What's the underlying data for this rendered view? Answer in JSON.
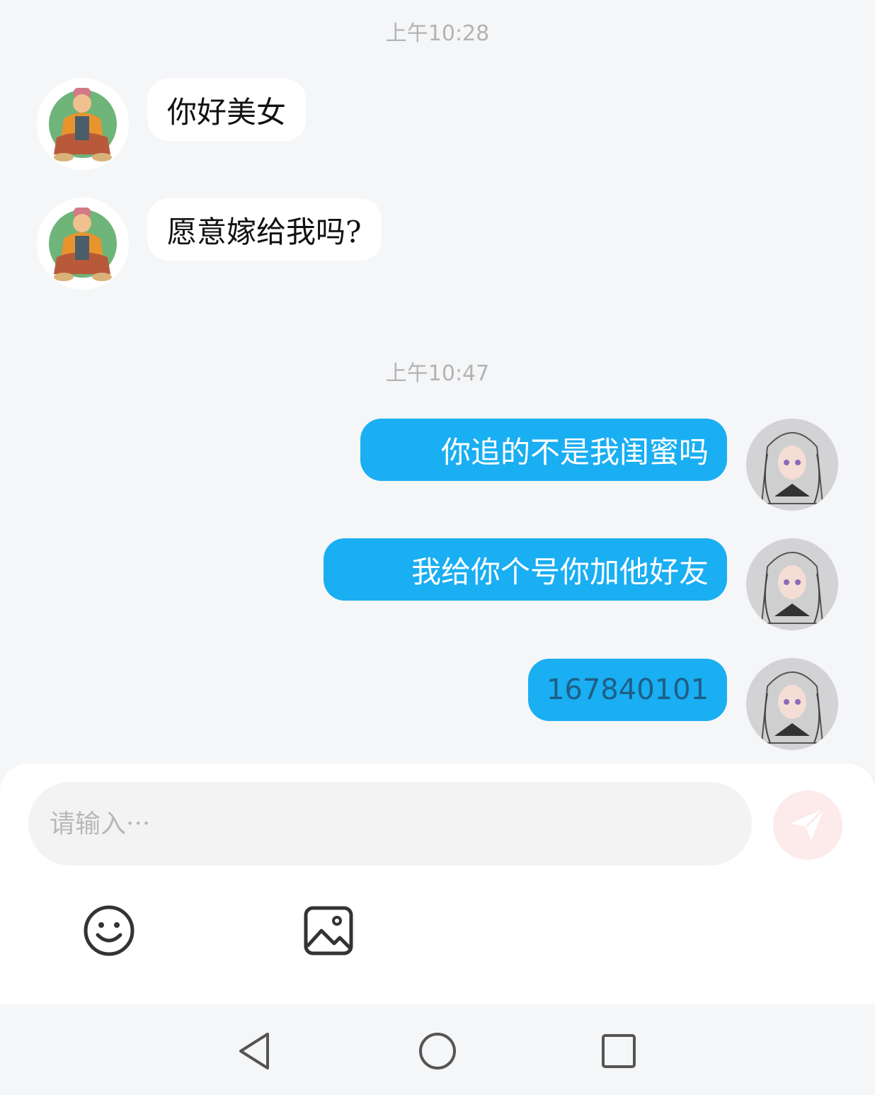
{
  "messages": [
    {
      "kind": "timestamp",
      "text": "上午10:28"
    },
    {
      "kind": "incoming",
      "sender": "contact",
      "text": "你好美女"
    },
    {
      "kind": "incoming",
      "sender": "contact",
      "text": "愿意嫁给我吗?"
    },
    {
      "kind": "timestamp",
      "text": "上午10:47"
    },
    {
      "kind": "outgoing",
      "sender": "me",
      "text": "你追的不是我闺蜜吗"
    },
    {
      "kind": "outgoing",
      "sender": "me",
      "text": "我给你个号你加他好友"
    },
    {
      "kind": "outgoing",
      "sender": "me",
      "text": "167840101"
    }
  ],
  "composer": {
    "placeholder": "请输入···",
    "value": "",
    "send_icon": "paper-plane-icon",
    "tools": [
      {
        "name": "emoji",
        "icon": "smiley-icon"
      },
      {
        "name": "image",
        "icon": "image-icon"
      }
    ]
  },
  "navbar": {
    "buttons": [
      {
        "name": "back",
        "icon": "triangle-back-icon"
      },
      {
        "name": "home",
        "icon": "circle-home-icon"
      },
      {
        "name": "recents",
        "icon": "square-recents-icon"
      }
    ]
  },
  "colors": {
    "background": "#f5f6f8",
    "outgoing_bubble": "#1aaef2",
    "incoming_bubble": "#ffffff",
    "timestamp": "#b3b3b3",
    "send_button": "#fdeaea"
  }
}
